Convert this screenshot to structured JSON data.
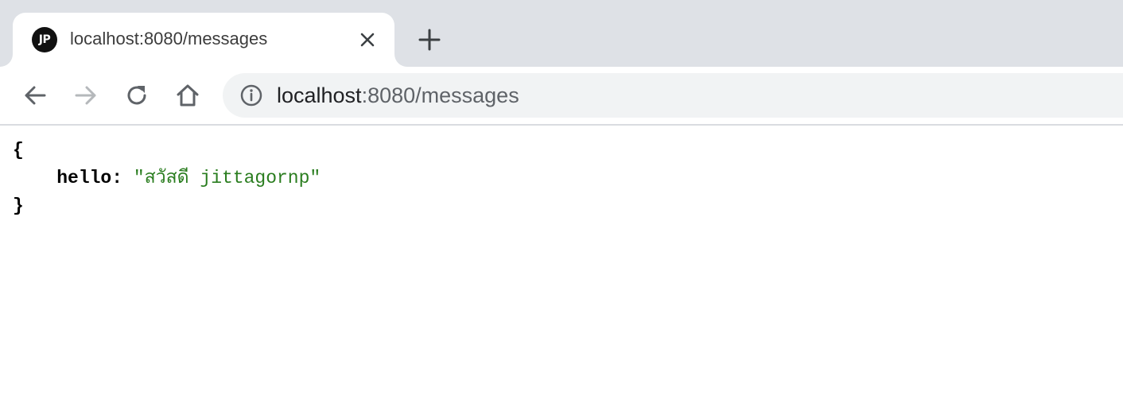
{
  "tab": {
    "favicon_text": "JP",
    "title": "localhost:8080/messages"
  },
  "omnibox": {
    "host": "localhost",
    "path": ":8080/messages"
  },
  "json_view": {
    "open_brace": "{",
    "key": "hello:",
    "value": "\"สวัสดี jittagornp\"",
    "close_brace": "}"
  },
  "colors": {
    "tabstrip_bg": "#dee1e6",
    "omnibox_bg": "#f1f3f4",
    "string_value": "#2a7d1f"
  },
  "icons": {
    "back": "arrow-left-icon",
    "forward": "arrow-right-icon",
    "reload": "reload-icon",
    "home": "home-icon",
    "info": "info-icon",
    "close": "close-icon",
    "new_tab": "plus-icon"
  },
  "states": {
    "forward_enabled": false
  }
}
